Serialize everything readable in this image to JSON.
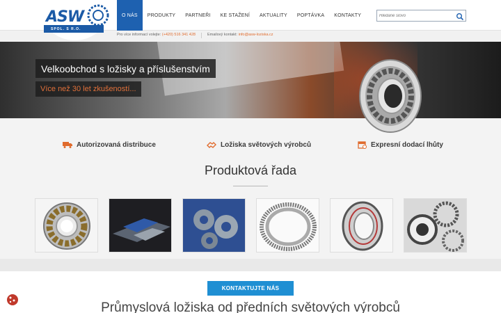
{
  "header": {
    "logo_text": "ASW",
    "logo_sub": "SPOL. S R.O.",
    "nav": [
      {
        "label": "O NÁS",
        "active": true
      },
      {
        "label": "PRODUKTY",
        "active": false
      },
      {
        "label": "PARTNEŘI",
        "active": false
      },
      {
        "label": "KE STAŽENÍ",
        "active": false
      },
      {
        "label": "AKTUALITY",
        "active": false
      },
      {
        "label": "POPTÁVKA",
        "active": false
      },
      {
        "label": "KONTAKTY",
        "active": false
      }
    ],
    "search_placeholder": "Hledané slovo",
    "info_phone_label": "Pro více informací volejte:",
    "info_phone": "(+420) 516 341 428",
    "info_email_label": "Emailový kontakt:",
    "info_email": "info@asw-loziska.cz"
  },
  "hero": {
    "title": "Velkoobchod s ložisky a příslušenstvím",
    "subtitle": "Více než 30 let zkušeností..."
  },
  "features": [
    {
      "label": "Autorizovaná distribuce",
      "icon": "truck-icon"
    },
    {
      "label": "Ložiska světových výrobců",
      "icon": "handshake-icon"
    },
    {
      "label": "Expresní dodací lhůty",
      "icon": "calendar-icon"
    }
  ],
  "products_title": "Produktová řada",
  "products": [
    {
      "name": "spherical-roller-bearing"
    },
    {
      "name": "linear-guide"
    },
    {
      "name": "bearing-housing-units"
    },
    {
      "name": "slewing-ring"
    },
    {
      "name": "ball-bearing"
    },
    {
      "name": "industrial-gears"
    }
  ],
  "cta_label": "KONTAKTUJTE NÁS",
  "bottom_title": "Průmyslová ložiska od předních světových výrobců",
  "colors": {
    "primary": "#1e61b0",
    "accent": "#e06b2d",
    "cta": "#1f8fd3"
  }
}
